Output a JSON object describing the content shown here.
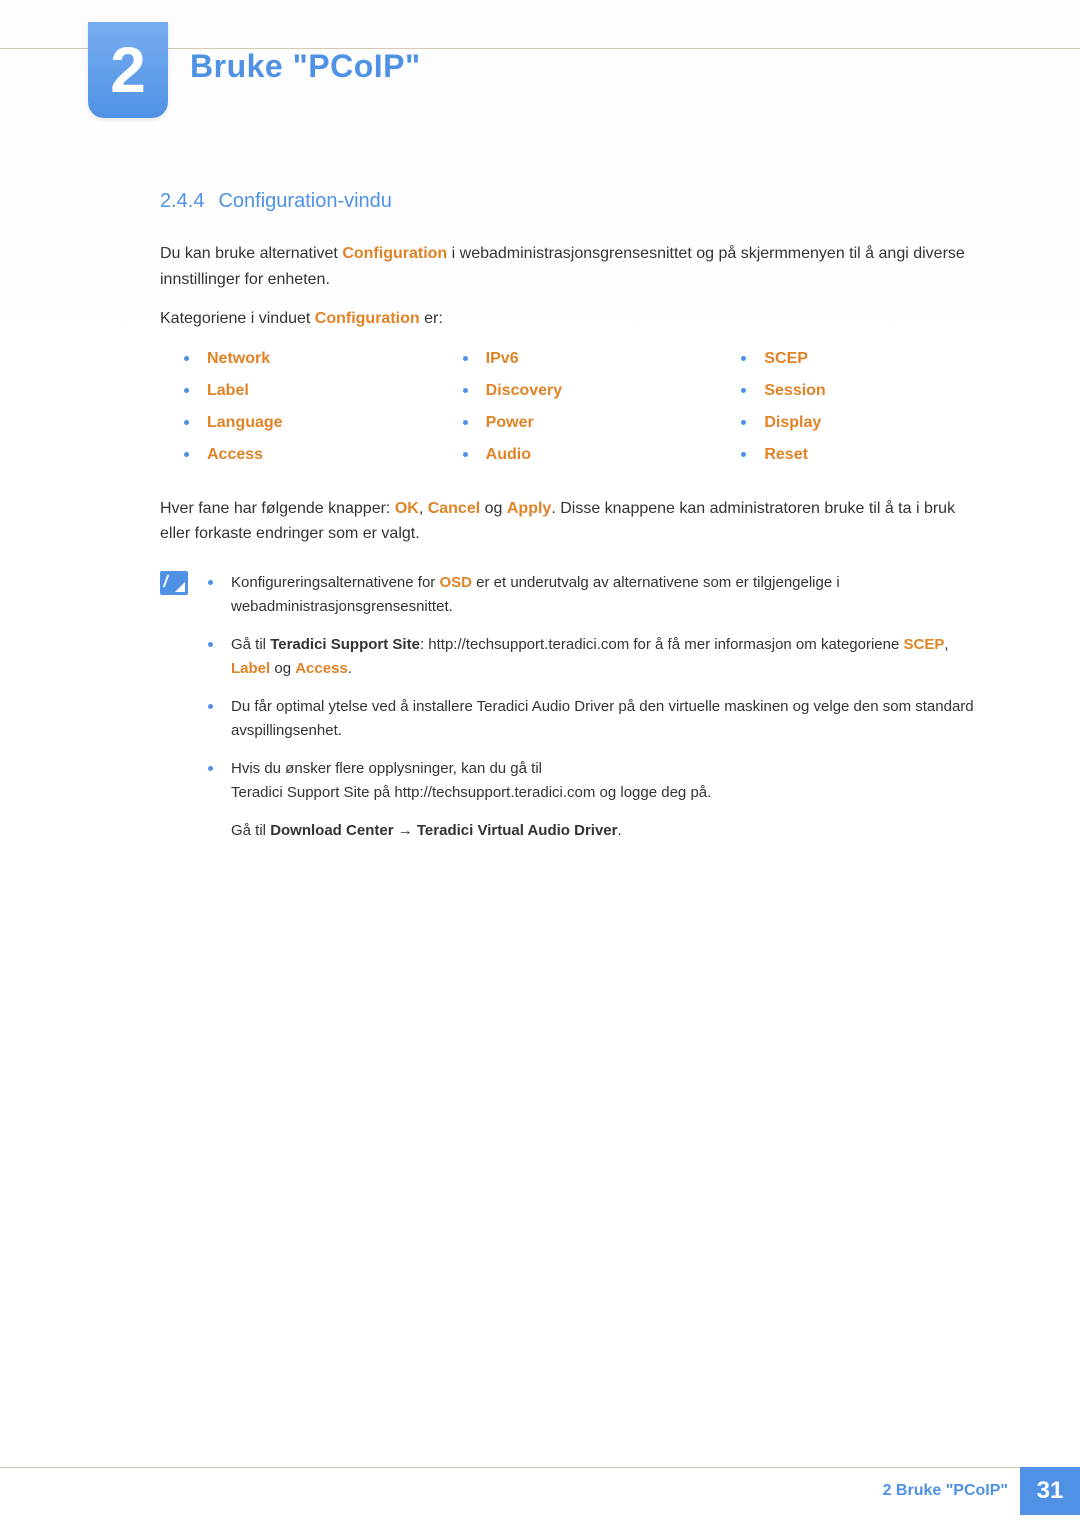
{
  "chapter": {
    "number": "2",
    "title": "Bruke \"PCoIP\""
  },
  "section": {
    "number": "2.4.4",
    "title": "Configuration-vindu"
  },
  "intro": {
    "pre": "Du kan bruke alternativet ",
    "kw1": "Configuration",
    "post": " i webadministrasjonsgrensesnittet og på skjermmenyen til å angi diverse innstillinger for enheten."
  },
  "catline": {
    "pre": "Kategoriene i vinduet ",
    "kw": "Configuration",
    "post": " er:"
  },
  "cats": {
    "col1": [
      "Network",
      "Label",
      "Language",
      "Access"
    ],
    "col2": [
      "IPv6",
      "Discovery",
      "Power",
      "Audio"
    ],
    "col3": [
      "SCEP",
      "Session",
      "Display",
      "Reset"
    ]
  },
  "buttons_para": {
    "pre": "Hver fane har følgende knapper: ",
    "b1": "OK",
    "sep1": ", ",
    "b2": "Cancel",
    "sep2": " og ",
    "b3": "Apply",
    "post": ". Disse knappene kan administratoren bruke til å ta i bruk eller forkaste endringer som er valgt."
  },
  "notes": {
    "n1": {
      "pre": "Konfigureringsalternativene for ",
      "kw": "OSD",
      "post": " er et underutvalg av alternativene som er tilgjengelige i webadministrasjonsgrensesnittet."
    },
    "n2": {
      "pre": "Gå til ",
      "b": "Teradici Support Site",
      "post1": ": http://techsupport.teradici.com for å få mer informasjon om kategoriene ",
      "k1": "SCEP",
      "s1": ", ",
      "k2": "Label",
      "s2": " og ",
      "k3": "Access",
      "end": "."
    },
    "n3": "Du får optimal ytelse ved å installere Teradici Audio Driver på den virtuelle maskinen og velge den som standard avspillingsenhet.",
    "n4": {
      "line1": "Hvis du ønsker flere opplysninger, kan du gå til",
      "line2": "Teradici Support Site på http://techsupport.teradici.com og logge deg på."
    },
    "tail": {
      "pre": "Gå til ",
      "b1": "Download Center",
      "arrow": " → ",
      "b2": "Teradici Virtual Audio Driver",
      "end": "."
    }
  },
  "footer": {
    "text": "2 Bruke \"PCoIP\"",
    "page": "31"
  }
}
